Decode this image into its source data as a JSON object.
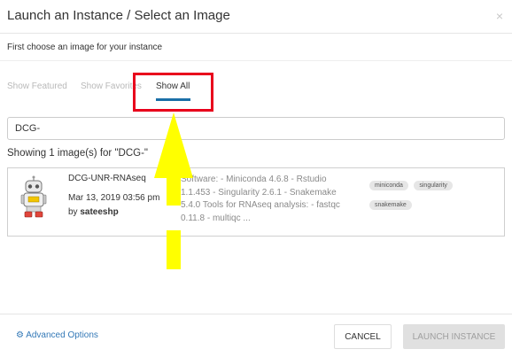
{
  "modal": {
    "title": "Launch an Instance / Select an Image",
    "close_label": "×",
    "intro": "First choose an image for your instance"
  },
  "tabs": [
    {
      "label": "Show Featured",
      "active": false
    },
    {
      "label": "Show Favorites",
      "active": false
    },
    {
      "label": "Show All",
      "active": true
    }
  ],
  "search": {
    "value": "DCG-",
    "placeholder": ""
  },
  "results": {
    "summary": "Showing 1 image(s) for \"DCG-\"",
    "items": [
      {
        "name": "DCG-UNR-RNAseq",
        "date": "Mar 13, 2019 03:56 pm",
        "by_prefix": "by",
        "author": "sateeshp",
        "description": "Software: - Miniconda 4.6.8 - Rstudio 1.1.453 - Singularity 2.6.1 - Snakemake 5.4.0 Tools for RNAseq analysis: - fastqc 0.11.8 - multiqc ...",
        "tags": [
          "miniconda",
          "singularity",
          "snakemake"
        ],
        "avatar_icon": "robot-icon"
      }
    ]
  },
  "footer": {
    "advanced_icon": "gear-icon",
    "advanced_label": "Advanced Options",
    "cancel_label": "CANCEL",
    "launch_label": "LAUNCH INSTANCE"
  },
  "annotations": {
    "highlight_color": "#e8001c",
    "arrow_color": "#ffff00"
  },
  "colors": {
    "accent": "#1a6fa8",
    "link": "#3479b7",
    "disabled_button": "#e0e0e0"
  }
}
